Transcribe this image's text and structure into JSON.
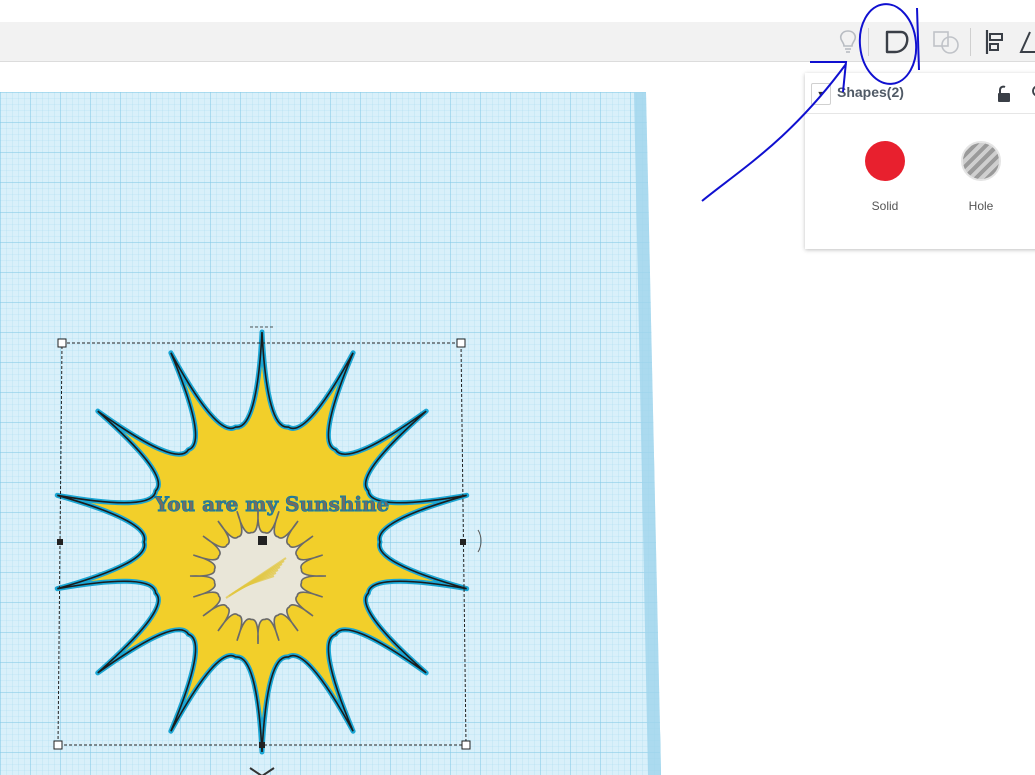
{
  "toolbar": {
    "items": [
      {
        "name": "lightbulb-icon"
      },
      {
        "name": "group-shape-icon"
      },
      {
        "name": "shape-union-icon"
      },
      {
        "name": "align-icon"
      },
      {
        "name": "mirror-icon"
      }
    ]
  },
  "inspector": {
    "title": "Shapes(2)",
    "solid_label": "Solid",
    "hole_label": "Hole",
    "solid_color": "#e8202e",
    "hole_color": "#b3b3b3"
  },
  "canvas": {
    "text_label": "You are my Sunshine",
    "grid_color": "#bfe6f5",
    "sun_color": "#f2cf2a",
    "outline_color": "#1aa6d4"
  },
  "annotation": {
    "color": "#1010d0"
  }
}
